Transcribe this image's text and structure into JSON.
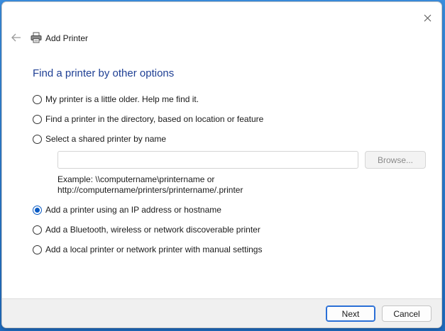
{
  "window": {
    "title": "Add Printer",
    "heading": "Find a printer by other options"
  },
  "options": [
    {
      "label": "My printer is a little older. Help me find it.",
      "checked": false
    },
    {
      "label": "Find a printer in the directory, based on location or feature",
      "checked": false
    },
    {
      "label": "Select a shared printer by name",
      "checked": false
    },
    {
      "label": "Add a printer using an IP address or hostname",
      "checked": true
    },
    {
      "label": "Add a Bluetooth, wireless or network discoverable printer",
      "checked": false
    },
    {
      "label": "Add a local printer or network printer with manual settings",
      "checked": false
    }
  ],
  "shared_printer": {
    "value": "",
    "browse_label": "Browse...",
    "example_line1": "Example: \\\\computername\\printername or",
    "example_line2": "http://computername/printers/printername/.printer"
  },
  "footer": {
    "next_label": "Next",
    "cancel_label": "Cancel"
  },
  "colors": {
    "heading": "#1e3f94",
    "accent": "#0a5bc4",
    "footer_bg": "#f0f0f0"
  }
}
